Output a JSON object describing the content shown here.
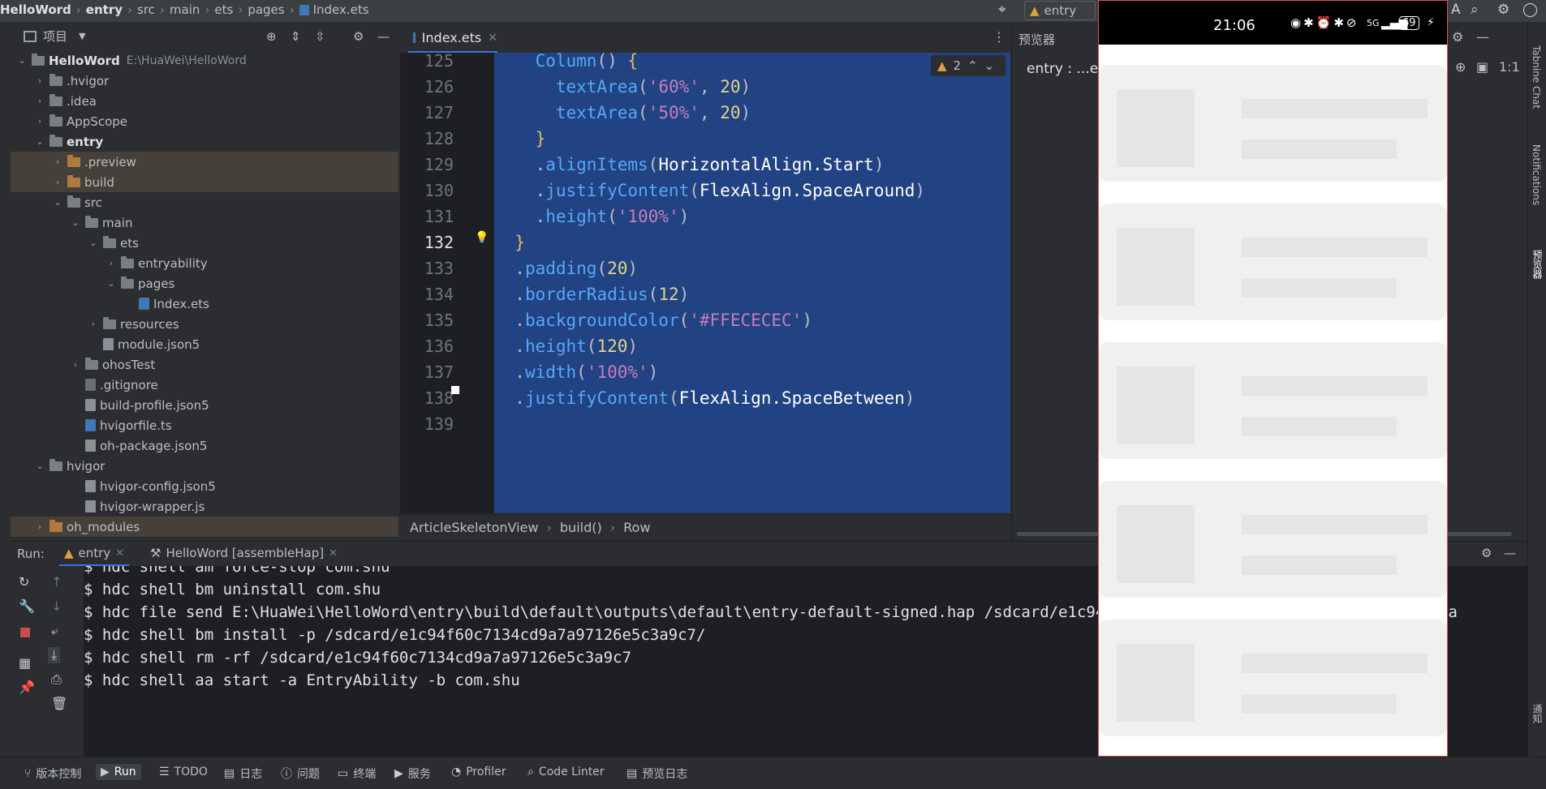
{
  "titlebar": {
    "breadcrumb": [
      "HelloWord",
      "entry",
      "src",
      "main",
      "ets",
      "pages",
      "Index.ets"
    ],
    "run_config": "entry"
  },
  "project": {
    "title": "项目",
    "root": {
      "name": "HelloWord",
      "path": "E:\\HuaWei\\HelloWord"
    },
    "items": [
      {
        "label": ".hvigor",
        "depth": 1,
        "kind": "folder",
        "arrow": "›"
      },
      {
        "label": ".idea",
        "depth": 1,
        "kind": "folder",
        "arrow": "›"
      },
      {
        "label": "AppScope",
        "depth": 1,
        "kind": "folder",
        "arrow": "›"
      },
      {
        "label": "entry",
        "depth": 1,
        "kind": "folder",
        "arrow": "⌄",
        "bold": true
      },
      {
        "label": ".preview",
        "depth": 2,
        "kind": "folder-orange",
        "arrow": "›",
        "highlight": true
      },
      {
        "label": "build",
        "depth": 2,
        "kind": "folder-orange",
        "arrow": "›",
        "highlight": true
      },
      {
        "label": "src",
        "depth": 2,
        "kind": "folder",
        "arrow": "⌄"
      },
      {
        "label": "main",
        "depth": 3,
        "kind": "folder",
        "arrow": "⌄"
      },
      {
        "label": "ets",
        "depth": 4,
        "kind": "folder",
        "arrow": "⌄"
      },
      {
        "label": "entryability",
        "depth": 5,
        "kind": "folder",
        "arrow": "›"
      },
      {
        "label": "pages",
        "depth": 5,
        "kind": "folder",
        "arrow": "⌄"
      },
      {
        "label": "Index.ets",
        "depth": 6,
        "kind": "file-ts",
        "arrow": ""
      },
      {
        "label": "resources",
        "depth": 4,
        "kind": "folder",
        "arrow": "›"
      },
      {
        "label": "module.json5",
        "depth": 4,
        "kind": "file-json",
        "arrow": ""
      },
      {
        "label": "ohosTest",
        "depth": 3,
        "kind": "folder",
        "arrow": "›"
      },
      {
        "label": ".gitignore",
        "depth": 3,
        "kind": "file-git",
        "arrow": ""
      },
      {
        "label": "build-profile.json5",
        "depth": 3,
        "kind": "file-json",
        "arrow": ""
      },
      {
        "label": "hvigorfile.ts",
        "depth": 3,
        "kind": "file-ts",
        "arrow": ""
      },
      {
        "label": "oh-package.json5",
        "depth": 3,
        "kind": "file-json",
        "arrow": ""
      },
      {
        "label": "hvigor",
        "depth": 1,
        "kind": "folder",
        "arrow": "⌄"
      },
      {
        "label": "hvigor-config.json5",
        "depth": 3,
        "kind": "file-json",
        "arrow": ""
      },
      {
        "label": "hvigor-wrapper.js",
        "depth": 3,
        "kind": "file-json",
        "arrow": ""
      },
      {
        "label": "oh_modules",
        "depth": 1,
        "kind": "folder-orange",
        "arrow": "›",
        "highlight": true
      }
    ]
  },
  "editor": {
    "tab": "Index.ets",
    "warnings": "2",
    "lines": [
      {
        "n": "125",
        "code": "    Column() {"
      },
      {
        "n": "126",
        "code": "      textArea('60%', 20)"
      },
      {
        "n": "127",
        "code": "      textArea('50%', 20)"
      },
      {
        "n": "128",
        "code": "    }"
      },
      {
        "n": "129",
        "code": "    .alignItems(HorizontalAlign.Start)"
      },
      {
        "n": "130",
        "code": "    .justifyContent(FlexAlign.SpaceAround)"
      },
      {
        "n": "131",
        "code": "    .height('100%')"
      },
      {
        "n": "132",
        "code": "  }"
      },
      {
        "n": "133",
        "code": "  .padding(20)"
      },
      {
        "n": "134",
        "code": "  .borderRadius(12)"
      },
      {
        "n": "135",
        "code": "  .backgroundColor('#FFECECEC')"
      },
      {
        "n": "136",
        "code": "  .height(120)"
      },
      {
        "n": "137",
        "code": "  .width('100%')"
      },
      {
        "n": "138",
        "code": "  .justifyContent(FlexAlign.SpaceBetween)"
      },
      {
        "n": "139",
        "code": ""
      }
    ],
    "breadcrumb": [
      "ArticleSkeletonView",
      "build()",
      "Row"
    ]
  },
  "previewer": {
    "title": "预览器",
    "device_label": "entry : ...es",
    "status_time": "21:06",
    "battery": "69",
    "signal": "5G",
    "cards": 5
  },
  "right_strip": [
    "Tabnine Chat",
    "Notifications",
    "预览器",
    "通知"
  ],
  "run": {
    "label": "Run:",
    "tabs": [
      "entry",
      "HelloWord [assembleHap]"
    ],
    "console": [
      "$ hdc shell am force-stop com.shu",
      "$ hdc shell bm uninstall com.shu",
      "$ hdc file send E:\\HuaWei\\HelloWord\\entry\\build\\default\\outputs\\default\\entry-default-signed.hap /sdcard/e1c94f60c7134cd9a7a97126e5c3a9c7/entry-defa",
      "$ hdc shell bm install -p /sdcard/e1c94f60c7134cd9a7a97126e5c3a9c7/",
      "$ hdc shell rm -rf /sdcard/e1c94f60c7134cd9a7a97126e5c3a9c7",
      "$ hdc shell aa start -a EntryAbility -b com.shu"
    ]
  },
  "bottombar": [
    "版本控制",
    "Run",
    "TODO",
    "日志",
    "问题",
    "终端",
    "服务",
    "Profiler",
    "Code Linter",
    "预览日志"
  ]
}
